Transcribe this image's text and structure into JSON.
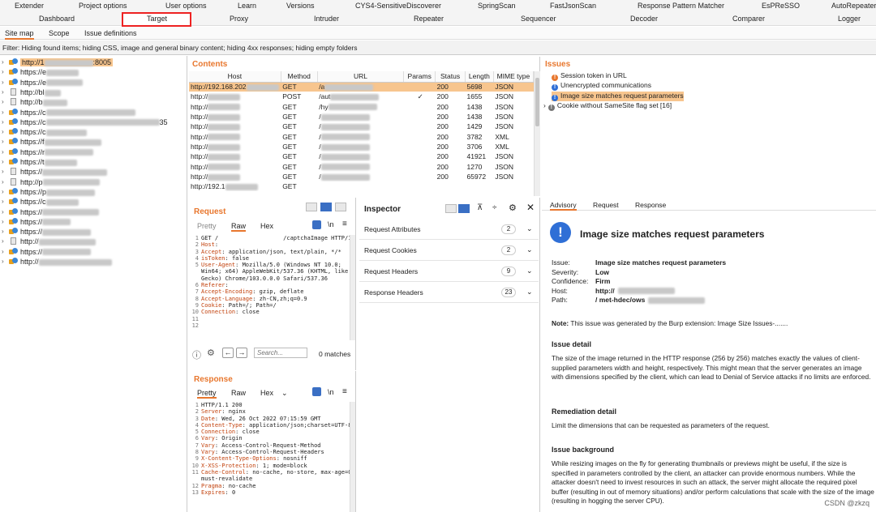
{
  "menu": {
    "row1": [
      "Extender",
      "Project options",
      "User options",
      "Learn",
      "Versions",
      "CYS4-SensitiveDiscoverer",
      "SpringScan",
      "FastJsonScan",
      "Response Pattern Matcher",
      "EsPReSSO",
      "AutoRepeater"
    ],
    "row2": [
      "Dashboard",
      "Target",
      "Proxy",
      "Intruder",
      "Repeater",
      "Sequencer",
      "Decoder",
      "Comparer",
      "Logger"
    ]
  },
  "subtabs": [
    "Site map",
    "Scope",
    "Issue definitions"
  ],
  "filter_text": "Filter: Hiding      found items;  hiding CSS, image and general binary content;  hiding 4xx responses;  hiding empty folders",
  "sitemap": [
    {
      "label": "http://1",
      "suffix": ":8005",
      "selected": true,
      "icon": "lock-globe"
    },
    {
      "label": "https://e",
      "suffix": "",
      "icon": "lock-globe"
    },
    {
      "label": "https://e",
      "suffix": "",
      "icon": "lock-globe"
    },
    {
      "label": "http://bl",
      "suffix": "",
      "icon": "page"
    },
    {
      "label": "http://b",
      "suffix": "",
      "icon": "page"
    },
    {
      "label": "https://c",
      "suffix": "",
      "icon": "lock-globe"
    },
    {
      "label": "https://c",
      "suffix": "35",
      "icon": "lock-globe"
    },
    {
      "label": "https://c",
      "suffix": "",
      "icon": "lock-globe"
    },
    {
      "label": "https://f",
      "suffix": "",
      "icon": "lock-globe"
    },
    {
      "label": "https://r",
      "suffix": "",
      "icon": "lock-globe"
    },
    {
      "label": "https://t",
      "suffix": "",
      "icon": "lock-globe"
    },
    {
      "label": "https://",
      "suffix": "",
      "icon": "page"
    },
    {
      "label": "http://p",
      "suffix": "",
      "icon": "page"
    },
    {
      "label": "https://p",
      "suffix": "",
      "icon": "lock-globe"
    },
    {
      "label": "https://c",
      "suffix": "",
      "icon": "lock-globe"
    },
    {
      "label": "https://",
      "suffix": "",
      "icon": "lock-globe"
    },
    {
      "label": "https://",
      "suffix": "",
      "icon": "lock-globe"
    },
    {
      "label": "https://",
      "suffix": "",
      "icon": "lock-globe"
    },
    {
      "label": "http://",
      "suffix": "",
      "icon": "page"
    },
    {
      "label": "https://",
      "suffix": "",
      "icon": "lock-globe"
    },
    {
      "label": "http://",
      "suffix": "",
      "icon": "lock-globe"
    }
  ],
  "contents": {
    "title": "Contents",
    "columns": [
      "Host",
      "Method",
      "URL",
      "Params",
      "Status",
      "Length",
      "MIME type"
    ],
    "rows": [
      {
        "host": "http://192.168.202",
        "method": "GET",
        "url": "/a",
        "params": "",
        "status": "200",
        "length": "5698",
        "mime": "JSON",
        "selected": true
      },
      {
        "host": "http://",
        "method": "POST",
        "url": "/aut",
        "params": "✓",
        "status": "200",
        "length": "1655",
        "mime": "JSON"
      },
      {
        "host": "http://",
        "method": "GET",
        "url": "/hy",
        "params": "",
        "status": "200",
        "length": "1438",
        "mime": "JSON"
      },
      {
        "host": "http://",
        "method": "GET",
        "url": "/",
        "params": "",
        "status": "200",
        "length": "1438",
        "mime": "JSON"
      },
      {
        "host": "http://",
        "method": "GET",
        "url": "/",
        "params": "",
        "status": "200",
        "length": "1429",
        "mime": "JSON"
      },
      {
        "host": "http://",
        "method": "GET",
        "url": "/",
        "params": "",
        "status": "200",
        "length": "3782",
        "mime": "XML"
      },
      {
        "host": "http://",
        "method": "GET",
        "url": "/",
        "params": "",
        "status": "200",
        "length": "3706",
        "mime": "XML"
      },
      {
        "host": "http://",
        "method": "GET",
        "url": "/",
        "params": "",
        "status": "200",
        "length": "41921",
        "mime": "JSON"
      },
      {
        "host": "http://",
        "method": "GET",
        "url": "/",
        "params": "",
        "status": "200",
        "length": "1270",
        "mime": "JSON"
      },
      {
        "host": "http://",
        "method": "GET",
        "url": "/",
        "params": "",
        "status": "200",
        "length": "65972",
        "mime": "JSON"
      },
      {
        "host": "http://192.1",
        "method": "GET",
        "url": "",
        "params": "",
        "status": "",
        "length": "",
        "mime": ""
      }
    ]
  },
  "issues": {
    "title": "Issues",
    "items": [
      {
        "label": "Session token in URL",
        "color": "#e8772e",
        "selected": false
      },
      {
        "label": "Unencrypted communications",
        "color": "#2f6fd6",
        "selected": false
      },
      {
        "label": "Image size matches request parameters",
        "color": "#2f6fd6",
        "selected": true
      },
      {
        "label": "Cookie without SameSite flag set [16]",
        "color": "#777777",
        "selected": false
      }
    ]
  },
  "request": {
    "title": "Request",
    "tabs": [
      "Pretty",
      "Raw",
      "Hex"
    ],
    "search_placeholder": "Search...",
    "matches": "0 matches",
    "lines": [
      {
        "n": "1",
        "k": "",
        "v": "GET /                   /captchaImage HTTP/1.1"
      },
      {
        "n": "2",
        "k": "Host",
        "v": ":"
      },
      {
        "n": "3",
        "k": "Accept",
        "v": ": application/json, text/plain, */*"
      },
      {
        "n": "4",
        "k": "isToken",
        "v": ": false"
      },
      {
        "n": "5",
        "k": "User-Agent",
        "v": ": Mozilla/5.0 (Windows NT 10.0;"
      },
      {
        "n": "",
        "k": "",
        "v": "Win64; x64) AppleWebKit/537.36 (KHTML, like"
      },
      {
        "n": "",
        "k": "",
        "v": "Gecko) Chrome/103.0.0.0 Safari/537.36"
      },
      {
        "n": "6",
        "k": "Referer",
        "v": ":"
      },
      {
        "n": "7",
        "k": "Accept-Encoding",
        "v": ": gzip, deflate"
      },
      {
        "n": "8",
        "k": "Accept-Language",
        "v": ": zh-CN,zh;q=0.9"
      },
      {
        "n": "9",
        "k": "Cookie",
        "v": ": Path=/; Path=/"
      },
      {
        "n": "10",
        "k": "Connection",
        "v": ": close"
      },
      {
        "n": "11",
        "k": "",
        "v": ""
      },
      {
        "n": "12",
        "k": "",
        "v": ""
      }
    ]
  },
  "response": {
    "title": "Response",
    "tabs": [
      "Pretty",
      "Raw",
      "Hex"
    ],
    "lines": [
      {
        "n": "1",
        "k": "",
        "v": "HTTP/1.1 200"
      },
      {
        "n": "2",
        "k": "Server",
        "v": ": nginx"
      },
      {
        "n": "3",
        "k": "Date",
        "v": ": Wed, 26 Oct 2022 07:15:59 GMT"
      },
      {
        "n": "4",
        "k": "Content-Type",
        "v": ": application/json;charset=UTF-8"
      },
      {
        "n": "5",
        "k": "Connection",
        "v": ": close"
      },
      {
        "n": "6",
        "k": "Vary",
        "v": ": Origin"
      },
      {
        "n": "7",
        "k": "Vary",
        "v": ": Access-Control-Request-Method"
      },
      {
        "n": "8",
        "k": "Vary",
        "v": ": Access-Control-Request-Headers"
      },
      {
        "n": "9",
        "k": "X-Content-Type-Options",
        "v": ": nosniff"
      },
      {
        "n": "10",
        "k": "X-XSS-Protection",
        "v": ": 1; mode=block"
      },
      {
        "n": "11",
        "k": "Cache-Control",
        "v": ": no-cache, no-store, max-age=0,"
      },
      {
        "n": "",
        "k": "",
        "v": "must-revalidate"
      },
      {
        "n": "12",
        "k": "Pragma",
        "v": ": no-cache"
      },
      {
        "n": "13",
        "k": "Expires",
        "v": ": 0"
      }
    ]
  },
  "inspector": {
    "title": "Inspector",
    "rows": [
      {
        "label": "Request Attributes",
        "count": "2"
      },
      {
        "label": "Request Cookies",
        "count": "2"
      },
      {
        "label": "Request Headers",
        "count": "9"
      },
      {
        "label": "Response Headers",
        "count": "23"
      }
    ]
  },
  "advisory": {
    "tabs": [
      "Advisory",
      "Request",
      "Response"
    ],
    "heading": "Image size matches request parameters",
    "fields": [
      {
        "k": "Issue:",
        "v": "Image size matches request parameters"
      },
      {
        "k": "Severity:",
        "v": "Low"
      },
      {
        "k": "Confidence:",
        "v": "Firm"
      },
      {
        "k": "Host:",
        "v": "http://"
      },
      {
        "k": "Path:",
        "v": "/          met-hdec/ows"
      }
    ],
    "note_label": "Note:",
    "note": " This issue was generated by the Burp extension: Image Size Issues-.......",
    "detail_h": "Issue detail",
    "detail": "The size of the image returned in the HTTP response (256 by 256) matches exactly the values of client-supplied parameters width and height, respectively. This might mean that the server generates an image with dimensions specified by the client, which can lead to Denial of Service attacks if no limits are enforced.",
    "remed_h": "Remediation detail",
    "remed": "Limit the dimensions that can be requested as parameters of the request.",
    "bg_h": "Issue background",
    "bg": "While resizing images on the fly for generating thumbnails or previews might be useful, if the size is specified in parameters controlled by the client, an attacker can provide enormous numbers. While the attacker doesn't need to invest resources in such an attack, the server might allocate the required pixel buffer (resulting in out of memory situations) and/or perform calculations that scale with the size of the image (resulting in hogging the server CPU)."
  },
  "watermark": "CSDN @zkzq"
}
